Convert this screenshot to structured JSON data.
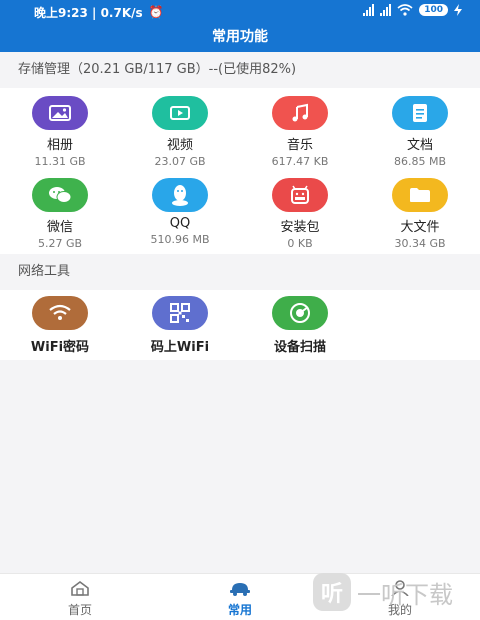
{
  "status_bar": {
    "time": "晚上9:23 | 0.7K/s",
    "battery": "100"
  },
  "header": {
    "title": "常用功能"
  },
  "storage": {
    "heading": "存储管理（20.21 GB/117 GB）--(已使用82%)",
    "items": [
      {
        "label": "相册",
        "size": "11.31 GB",
        "icon": "photo-icon",
        "color": "#6a4cc4"
      },
      {
        "label": "视频",
        "size": "23.07 GB",
        "icon": "video-icon",
        "color": "#1fbf9f"
      },
      {
        "label": "音乐",
        "size": "617.47 KB",
        "icon": "music-icon",
        "color": "#f0534f"
      },
      {
        "label": "文档",
        "size": "86.85 MB",
        "icon": "document-icon",
        "color": "#2aa7e8"
      },
      {
        "label": "微信",
        "size": "5.27 GB",
        "icon": "wechat-icon",
        "color": "#3fb24d"
      },
      {
        "label": "QQ",
        "size": "510.96 MB",
        "icon": "qq-icon",
        "color": "#29a6e9"
      },
      {
        "label": "安装包",
        "size": "0 KB",
        "icon": "apk-icon",
        "color": "#ea4a4a"
      },
      {
        "label": "大文件",
        "size": "30.34 GB",
        "icon": "folder-icon",
        "color": "#f3b81f"
      }
    ]
  },
  "network_tools": {
    "heading": "网络工具",
    "items": [
      {
        "label": "WiFi密码",
        "icon": "wifi-icon",
        "color": "#b06c3a"
      },
      {
        "label": "码上WiFi",
        "icon": "qr-code-icon",
        "color": "#5f6fcf"
      },
      {
        "label": "设备扫描",
        "icon": "scan-icon",
        "color": "#3fae4a"
      }
    ]
  },
  "bottom_nav": [
    {
      "label": "首页",
      "icon": "home-icon"
    },
    {
      "label": "常用",
      "icon": "car-icon"
    },
    {
      "label": "我的",
      "icon": "user-icon"
    }
  ],
  "watermark": {
    "text": "一听下载"
  }
}
